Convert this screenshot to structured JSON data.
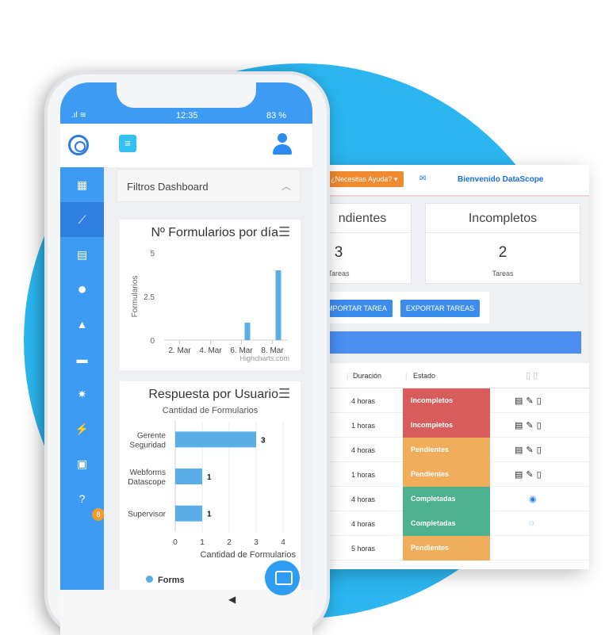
{
  "colors": {
    "bg_circle": "#2bb6f0",
    "sidebar": "#3d9bf3",
    "accent_blue": "#4a8ef0",
    "incompleto": "#d95c5c",
    "pendiente": "#f0ad5c",
    "completada": "#4db08f",
    "help_btn": "#ef8a2f"
  },
  "desktop": {
    "help_button": "¿Necesitas Ayuda? ▾",
    "welcome": "Bienvenido DataScope",
    "cards": [
      {
        "title": "ndientes",
        "value": "3",
        "label": "Tareas"
      },
      {
        "title": "Incompletos",
        "value": "2",
        "label": "Tareas"
      }
    ],
    "buttons": {
      "import": "MPORTAR TAREA",
      "export": "EXPORTAR TAREAS"
    },
    "table": {
      "headers": {
        "duracion": "Duración",
        "estado": "Estado"
      },
      "rows": [
        {
          "duracion": "4 horas",
          "estado": "Incompletos",
          "status": "incompleto"
        },
        {
          "duracion": "1 horas",
          "estado": "Incompletos",
          "status": "incompleto"
        },
        {
          "duracion": "4 horas",
          "estado": "Pendientes",
          "status": "pendiente"
        },
        {
          "duracion": "1 horas",
          "estado": "Pendientes",
          "status": "pendiente"
        },
        {
          "duracion": "4 horas",
          "estado": "Completadas",
          "status": "completada"
        },
        {
          "duracion": "4 horas",
          "estado": "Completadas",
          "status": "completada"
        },
        {
          "duracion": "5 horas",
          "estado": "Pendientes",
          "status": "pendiente"
        }
      ]
    }
  },
  "phone": {
    "status": {
      "time": "12:35",
      "battery": "83 %"
    },
    "badge": "8",
    "filter_title": "Filtros Dashboard",
    "nav_icons": [
      "grid-icon",
      "chart-line-icon",
      "calendar-icon",
      "location-pin-icon",
      "alert-icon",
      "archive-icon",
      "gear-icon",
      "plug-icon",
      "gift-icon",
      "help-icon"
    ],
    "watermark": "Highcharts.com"
  },
  "chart_data": [
    {
      "type": "bar",
      "title": "Nº Formularios por día",
      "ylabel": "Formularios",
      "ylim": [
        0,
        5
      ],
      "yticks": [
        "0",
        "2.5",
        "5"
      ],
      "xticks": [
        "2. Mar",
        "4. Mar",
        "6. Mar",
        "8. Mar"
      ],
      "x": [
        6,
        8
      ],
      "values": [
        1,
        4
      ]
    },
    {
      "type": "bar",
      "orientation": "horizontal",
      "title": "Respuesta por Usuario",
      "subtitle": "Cantidad de Formularios",
      "xlabel": "Cantidad de Formularios",
      "xlim": [
        0,
        4
      ],
      "xticks": [
        "0",
        "1",
        "2",
        "3",
        "4"
      ],
      "categories": [
        "Gerente Seguridad",
        "Webforms Datascope",
        "Supervisor"
      ],
      "series": [
        {
          "name": "Forms",
          "values": [
            3,
            1,
            1
          ]
        }
      ]
    }
  ]
}
